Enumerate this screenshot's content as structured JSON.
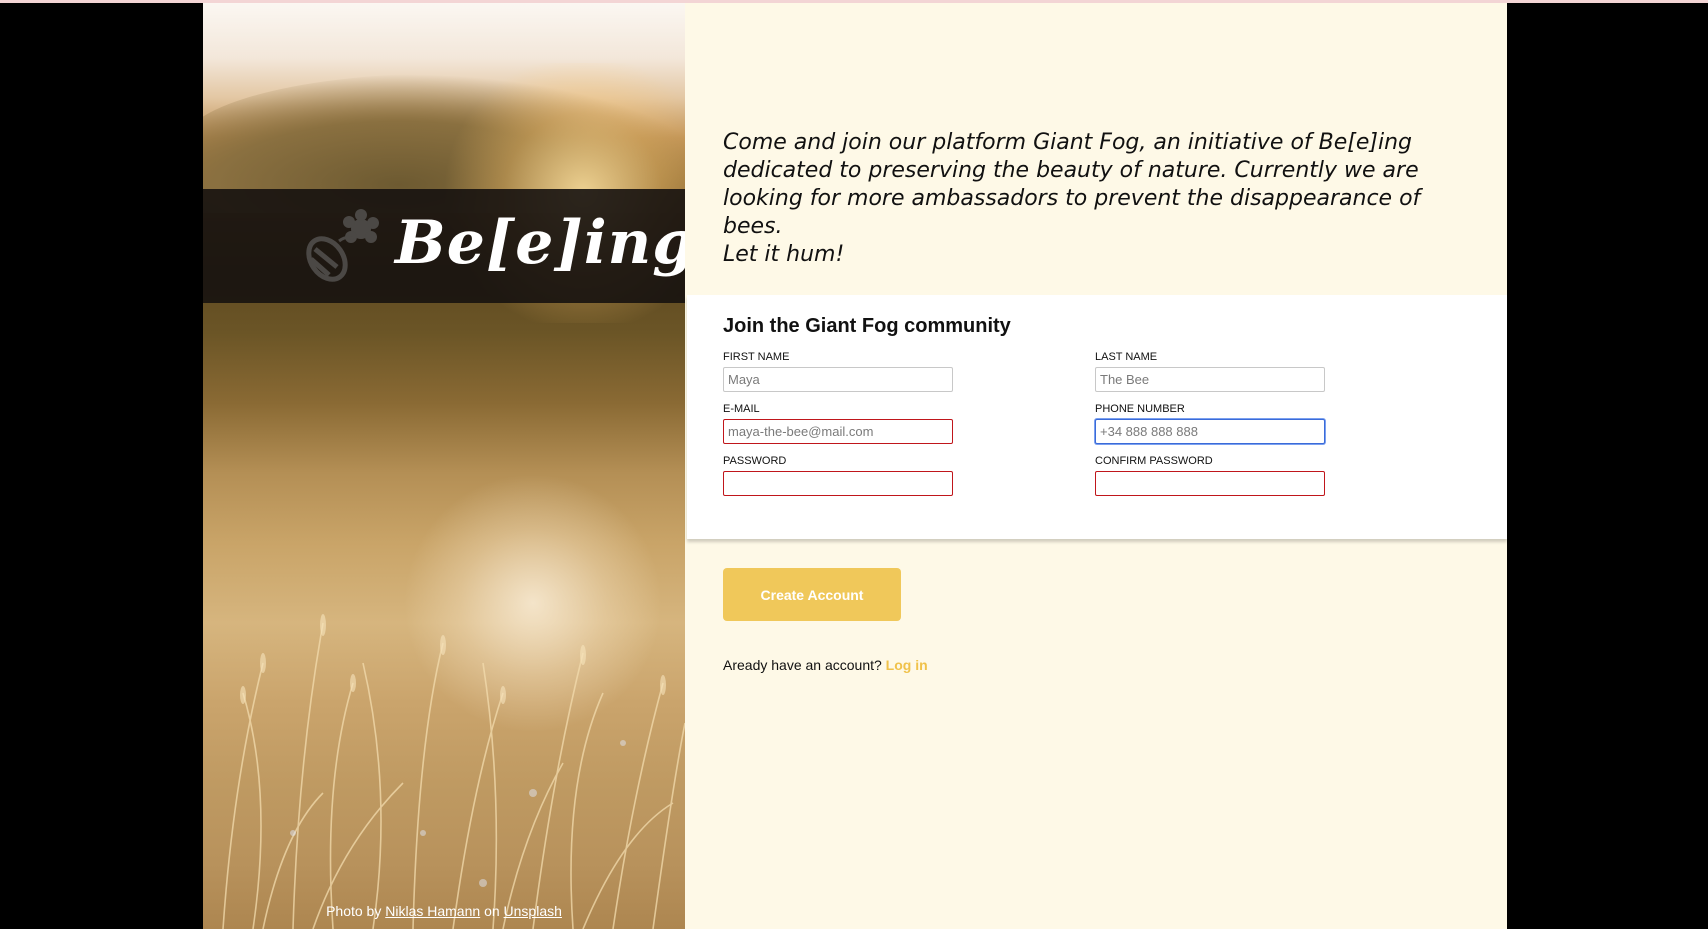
{
  "brand": {
    "name": "Be[e]ing",
    "logo_icon": "bee-flower-icon"
  },
  "photo_credit": {
    "prefix": "Photo by",
    "author": "Niklas Hamann",
    "middle": "on",
    "source": "Unsplash"
  },
  "intro": {
    "paragraph": "Come and join our platform Giant Fog, an initiative of Be[e]ing dedicated to preserving the beauty of nature. Currently we are looking for more ambassadors to prevent the disappearance of bees.",
    "tagline": "Let it hum!"
  },
  "form": {
    "title": "Join the Giant Fog community",
    "first_name": {
      "label": "FIRST NAME",
      "placeholder": "Maya"
    },
    "last_name": {
      "label": "LAST NAME",
      "placeholder": "The Bee"
    },
    "email": {
      "label": "E-MAIL",
      "placeholder": "maya-the-bee@mail.com"
    },
    "phone": {
      "label": "PHONE NUMBER",
      "placeholder": "+34 888 888 888"
    },
    "password": {
      "label": "PASSWORD",
      "placeholder": ""
    },
    "confirm_password": {
      "label": "CONFIRM PASSWORD",
      "placeholder": ""
    }
  },
  "actions": {
    "create_account": "Create Account",
    "login_prompt": "Aready have an account?",
    "login_link": "Log in"
  },
  "colors": {
    "accent": "#f0c85a",
    "error": "#c0161b",
    "focus": "#3b6bd8",
    "panel_bg": "#fef9e7"
  }
}
